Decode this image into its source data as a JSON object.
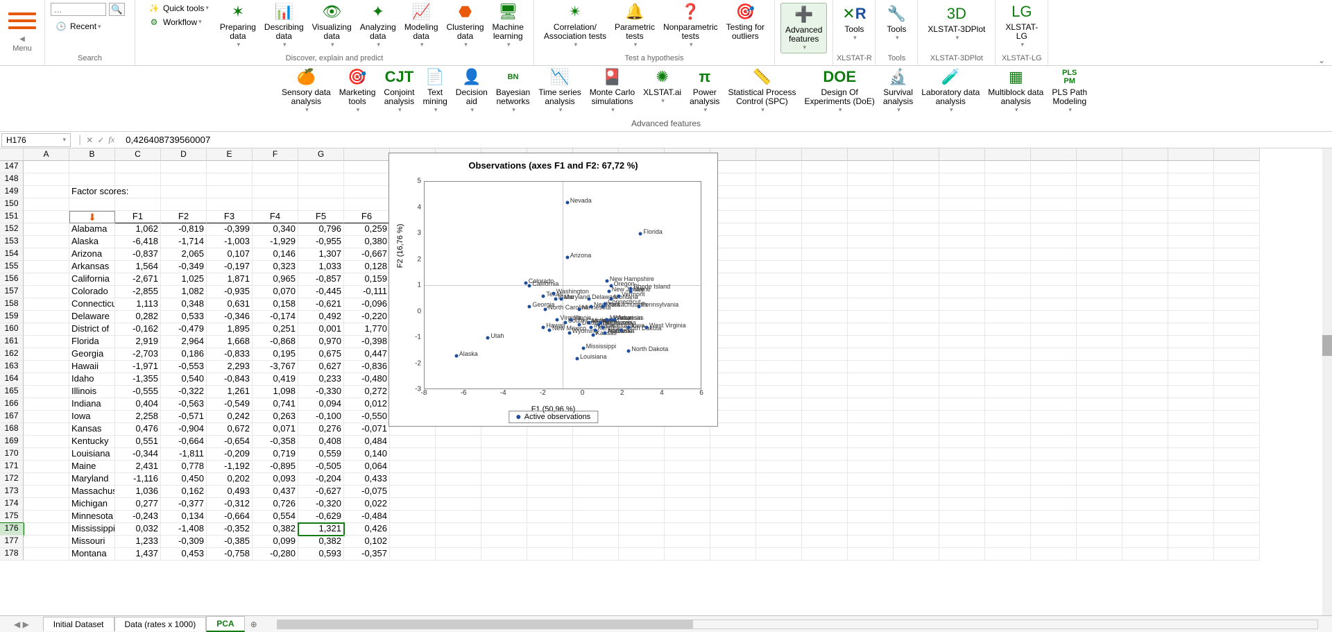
{
  "formula_bar": {
    "name_box": "H176",
    "value": "0,426408739560007"
  },
  "ribbon_top": {
    "menu": {
      "label": "Menu"
    },
    "search": {
      "label": "Search",
      "recent": "Recent",
      "placeholder": "..."
    },
    "discover": {
      "label": "Discover, explain and predict",
      "quick_tools": "Quick tools",
      "workflow": "Workflow",
      "prepare": "Preparing\ndata",
      "describe": "Describing\ndata",
      "visualize": "Visualizing\ndata",
      "analyze": "Analyzing\ndata",
      "model": "Modeling\ndata",
      "cluster": "Clustering\ndata",
      "ml": "Machine\nlearning"
    },
    "hypothesis": {
      "label": "Test a hypothesis",
      "corr": "Correlation/\nAssociation tests",
      "param": "Parametric\ntests",
      "nonparam": "Nonparametric\ntests",
      "outliers": "Testing for\noutliers"
    },
    "adv": {
      "label": "Advanced\nfeatures"
    },
    "xlstat_r": {
      "label": "XLSTAT-R",
      "tools": "Tools"
    },
    "tools": {
      "label": "Tools",
      "tools": "Tools"
    },
    "plot3d": {
      "label": "XLSTAT-3DPlot",
      "top": "XLSTAT-3DPlot"
    },
    "lg": {
      "label": "XLSTAT-LG",
      "top": "XLSTAT-\nLG"
    }
  },
  "ribbon_sub": {
    "label": "Advanced features",
    "sensory": "Sensory data\nanalysis",
    "marketing": "Marketing\ntools",
    "conjoint": "Conjoint\nanalysis",
    "text": "Text\nmining",
    "decision": "Decision\naid",
    "bayes": "Bayesian\nnetworks",
    "tseries": "Time series\nanalysis",
    "mc": "Monte Carlo\nsimulations",
    "ai": "XLSTAT.ai",
    "power": "Power\nanalysis",
    "spc": "Statistical Process\nControl (SPC)",
    "doe": "Design Of\nExperiments (DoE)",
    "survival": "Survival\nanalysis",
    "lab": "Laboratory data\nanalysis",
    "multi": "Multiblock data\nanalysis",
    "pls": "PLS Path\nModeling"
  },
  "worksheet": {
    "title_cell": "Factor scores:",
    "columns": [
      "A",
      "B",
      "C",
      "D",
      "E",
      "F",
      "G"
    ],
    "factor_heads": [
      "F1",
      "F2",
      "F3",
      "F4",
      "F5",
      "F6"
    ],
    "row_start": 147,
    "selected_cell": {
      "row": 176,
      "col": 7
    },
    "rows": [
      {
        "r": 152,
        "name": "Alabama",
        "v": [
          "1,062",
          "-0,819",
          "-0,399",
          "0,340",
          "0,796",
          "0,259"
        ]
      },
      {
        "r": 153,
        "name": "Alaska",
        "v": [
          "-6,418",
          "-1,714",
          "-1,003",
          "-1,929",
          "-0,955",
          "0,380"
        ]
      },
      {
        "r": 154,
        "name": "Arizona",
        "v": [
          "-0,837",
          "2,065",
          "0,107",
          "0,146",
          "1,307",
          "-0,667"
        ]
      },
      {
        "r": 155,
        "name": "Arkansas",
        "v": [
          "1,564",
          "-0,349",
          "-0,197",
          "0,323",
          "1,033",
          "0,128"
        ]
      },
      {
        "r": 156,
        "name": "California",
        "v": [
          "-2,671",
          "1,025",
          "1,871",
          "0,965",
          "-0,857",
          "0,159"
        ]
      },
      {
        "r": 157,
        "name": "Colorado",
        "v": [
          "-2,855",
          "1,082",
          "-0,935",
          "0,070",
          "-0,445",
          "-0,111"
        ]
      },
      {
        "r": 158,
        "name": "Connecticut",
        "v": [
          "1,113",
          "0,348",
          "0,631",
          "0,158",
          "-0,621",
          "-0,096"
        ]
      },
      {
        "r": 159,
        "name": "Delaware",
        "v": [
          "0,282",
          "0,533",
          "-0,346",
          "-0,174",
          "0,492",
          "-0,220"
        ]
      },
      {
        "r": 160,
        "name": "District of",
        "v": [
          "-0,162",
          "-0,479",
          "1,895",
          "0,251",
          "0,001",
          "1,770"
        ]
      },
      {
        "r": 161,
        "name": "Florida",
        "v": [
          "2,919",
          "2,964",
          "1,668",
          "-0,868",
          "0,970",
          "-0,398"
        ]
      },
      {
        "r": 162,
        "name": "Georgia",
        "v": [
          "-2,703",
          "0,186",
          "-0,833",
          "0,195",
          "0,675",
          "0,447"
        ]
      },
      {
        "r": 163,
        "name": "Hawaii",
        "v": [
          "-1,971",
          "-0,553",
          "2,293",
          "-3,767",
          "0,627",
          "-0,836"
        ]
      },
      {
        "r": 164,
        "name": "Idaho",
        "v": [
          "-1,355",
          "0,540",
          "-0,843",
          "0,419",
          "0,233",
          "-0,480"
        ]
      },
      {
        "r": 165,
        "name": "Illinois",
        "v": [
          "-0,555",
          "-0,322",
          "1,261",
          "1,098",
          "-0,330",
          "0,272"
        ]
      },
      {
        "r": 166,
        "name": "Indiana",
        "v": [
          "0,404",
          "-0,563",
          "-0,549",
          "0,741",
          "0,094",
          "0,012"
        ]
      },
      {
        "r": 167,
        "name": "Iowa",
        "v": [
          "2,258",
          "-0,571",
          "0,242",
          "0,263",
          "-0,100",
          "-0,550"
        ]
      },
      {
        "r": 168,
        "name": "Kansas",
        "v": [
          "0,476",
          "-0,904",
          "0,672",
          "0,071",
          "0,276",
          "-0,071"
        ]
      },
      {
        "r": 169,
        "name": "Kentucky",
        "v": [
          "0,551",
          "-0,664",
          "-0,654",
          "-0,358",
          "0,408",
          "0,484"
        ]
      },
      {
        "r": 170,
        "name": "Louisiana",
        "v": [
          "-0,344",
          "-1,811",
          "-0,209",
          "0,719",
          "0,559",
          "0,140"
        ]
      },
      {
        "r": 171,
        "name": "Maine",
        "v": [
          "2,431",
          "0,778",
          "-1,192",
          "-0,895",
          "-0,505",
          "0,064"
        ]
      },
      {
        "r": 172,
        "name": "Maryland",
        "v": [
          "-1,116",
          "0,450",
          "0,202",
          "0,093",
          "-0,204",
          "0,433"
        ]
      },
      {
        "r": 173,
        "name": "Massachusetts",
        "v": [
          "1,036",
          "0,162",
          "0,493",
          "0,437",
          "-0,627",
          "-0,075"
        ]
      },
      {
        "r": 174,
        "name": "Michigan",
        "v": [
          "0,277",
          "-0,377",
          "-0,312",
          "0,726",
          "-0,320",
          "0,022"
        ]
      },
      {
        "r": 175,
        "name": "Minnesota",
        "v": [
          "-0,243",
          "0,134",
          "-0,664",
          "0,554",
          "-0,629",
          "-0,484"
        ]
      },
      {
        "r": 176,
        "name": "Mississippi",
        "v": [
          "0,032",
          "-1,408",
          "-0,352",
          "0,382",
          "1,321",
          "0,426"
        ]
      },
      {
        "r": 177,
        "name": "Missouri",
        "v": [
          "1,233",
          "-0,309",
          "-0,385",
          "0,099",
          "0,382",
          "0,102"
        ]
      },
      {
        "r": 178,
        "name": "Montana",
        "v": [
          "1,437",
          "0,453",
          "-0,758",
          "-0,280",
          "0,593",
          "-0,357"
        ]
      }
    ]
  },
  "chart_data": {
    "type": "scatter",
    "title": "Observations (axes F1 and F2: 67,72 %)",
    "xlabel": "F1 (50,96 %)",
    "ylabel": "F2 (16,76 %)",
    "xlim": [
      -8,
      6
    ],
    "ylim": [
      -3,
      5
    ],
    "xticks": [
      -8,
      -6,
      -4,
      -2,
      0,
      2,
      4,
      6
    ],
    "yticks": [
      -3,
      -2,
      -1,
      0,
      1,
      2,
      3,
      4,
      5
    ],
    "legend": "Active observations",
    "series": [
      {
        "label": "Nevada",
        "x": -0.8,
        "y": 4.2
      },
      {
        "label": "Florida",
        "x": 2.9,
        "y": 3.0
      },
      {
        "label": "Arizona",
        "x": -0.8,
        "y": 2.1
      },
      {
        "label": "New Hampshire",
        "x": 1.2,
        "y": 1.2
      },
      {
        "label": "Oregon",
        "x": 1.4,
        "y": 1.0
      },
      {
        "label": "Rhode Island",
        "x": 2.4,
        "y": 0.9
      },
      {
        "label": "California",
        "x": -2.7,
        "y": 1.0
      },
      {
        "label": "Colorado",
        "x": -2.9,
        "y": 1.1
      },
      {
        "label": "New Jersey",
        "x": 1.3,
        "y": 0.8
      },
      {
        "label": "Maine",
        "x": 2.4,
        "y": 0.8
      },
      {
        "label": "Delaware",
        "x": 0.3,
        "y": 0.5
      },
      {
        "label": "Vermont",
        "x": 1.8,
        "y": 0.6
      },
      {
        "label": "Washington",
        "x": -1.5,
        "y": 0.7
      },
      {
        "label": "Maryland",
        "x": -1.1,
        "y": 0.5
      },
      {
        "label": "Texas",
        "x": -2.0,
        "y": 0.6
      },
      {
        "label": "Connecticut",
        "x": 1.1,
        "y": 0.3
      },
      {
        "label": "Massachusetts",
        "x": 1.0,
        "y": 0.2
      },
      {
        "label": "Pennsylvania",
        "x": 2.8,
        "y": 0.2
      },
      {
        "label": "New York",
        "x": 0.4,
        "y": 0.2
      },
      {
        "label": "Georgia",
        "x": -2.7,
        "y": 0.2
      },
      {
        "label": "North Carolina",
        "x": -1.9,
        "y": 0.1
      },
      {
        "label": "Idaho",
        "x": -1.4,
        "y": 0.5
      },
      {
        "label": "Minnesota",
        "x": -0.2,
        "y": 0.1
      },
      {
        "label": "Virginia",
        "x": -1.3,
        "y": -0.3
      },
      {
        "label": "South Carolina",
        "x": -0.9,
        "y": -0.4
      },
      {
        "label": "Illinois",
        "x": -0.6,
        "y": -0.3
      },
      {
        "label": "District of Columbia",
        "x": -0.2,
        "y": -0.5
      },
      {
        "label": "Hawaii",
        "x": -2.0,
        "y": -0.6
      },
      {
        "label": "New Mexico",
        "x": -1.7,
        "y": -0.7
      },
      {
        "label": "Wyoming",
        "x": -0.7,
        "y": -0.8
      },
      {
        "label": "Tennessee",
        "x": 0.8,
        "y": -0.5
      },
      {
        "label": "Arkansas",
        "x": 1.6,
        "y": -0.3
      },
      {
        "label": "Wisconsin",
        "x": 1.4,
        "y": -0.3
      },
      {
        "label": "Oklahoma",
        "x": 1.0,
        "y": -0.6
      },
      {
        "label": "Kentucky",
        "x": 0.6,
        "y": -0.7
      },
      {
        "label": "South Dakota",
        "x": 1.9,
        "y": -0.7
      },
      {
        "label": "Ohio",
        "x": 0.9,
        "y": -0.4
      },
      {
        "label": "Michigan",
        "x": 0.3,
        "y": -0.4
      },
      {
        "label": "West Virginia",
        "x": 3.2,
        "y": -0.6
      },
      {
        "label": "Kansas",
        "x": 0.5,
        "y": -0.9
      },
      {
        "label": "Indiana",
        "x": 0.4,
        "y": -0.6
      },
      {
        "label": "Iowa",
        "x": 2.3,
        "y": -0.6
      },
      {
        "label": "Nebraska",
        "x": 1.1,
        "y": -0.8
      },
      {
        "label": "Missouri",
        "x": 1.2,
        "y": -0.3
      },
      {
        "label": "Montana",
        "x": 1.4,
        "y": 0.5
      },
      {
        "label": "Utah",
        "x": -4.8,
        "y": -1.0
      },
      {
        "label": "Mississippi",
        "x": 0.0,
        "y": -1.4
      },
      {
        "label": "North Dakota",
        "x": 2.3,
        "y": -1.5
      },
      {
        "label": "Alaska",
        "x": -6.4,
        "y": -1.7
      },
      {
        "label": "Louisiana",
        "x": -0.3,
        "y": -1.8
      },
      {
        "label": "Alabama",
        "x": 1.1,
        "y": -0.8
      }
    ]
  },
  "tabs": {
    "t1": "Initial Dataset",
    "t2": "Data (rates x 1000)",
    "t3": "PCA"
  }
}
